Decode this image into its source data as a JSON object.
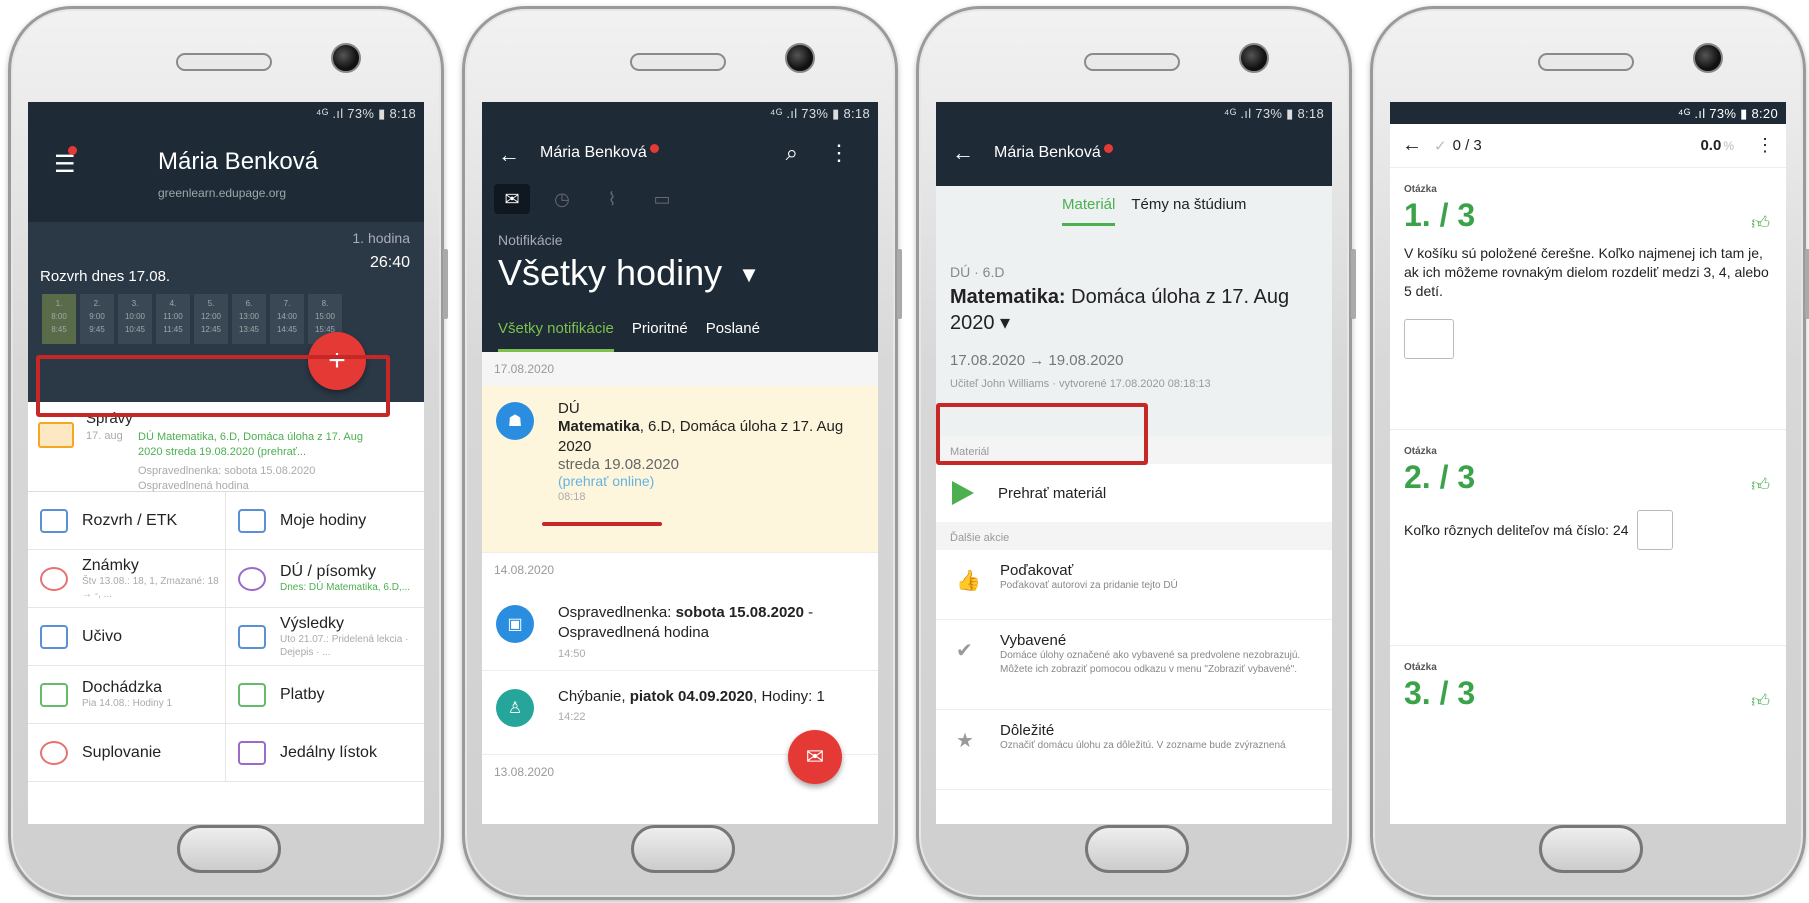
{
  "phone1": {
    "status": "⁴ᴳ .ıl 73% ▮ 8:18",
    "user_name": "Mária Benková",
    "domain": "greenlearn.edupage.org",
    "lesson_label": "1. hodina",
    "timer": "26:40",
    "schedule_title": "Rozvrh dnes 17.08.",
    "schedule_cells": [
      {
        "n": "1.",
        "t": "8:00\n8:45"
      },
      {
        "n": "2.",
        "t": "9:00\n9:45"
      },
      {
        "n": "3.",
        "t": "10:00\n10:45"
      },
      {
        "n": "4.",
        "t": "11:00\n11:45"
      },
      {
        "n": "5.",
        "t": "12:00\n12:45"
      },
      {
        "n": "6.",
        "t": "13:00\n13:45"
      },
      {
        "n": "7.",
        "t": "14:00\n14:45"
      },
      {
        "n": "8.",
        "t": "15:00\n15:45"
      }
    ],
    "fab": "+",
    "messages": {
      "title": "Správy",
      "date": "17. aug",
      "text": "DÚ Matematika, 6.D, Domáca úloha z 17. Aug 2020 streda 19.08.2020 (prehrať...",
      "sub": "Ospravedlnenka: sobota 15.08.2020 Ospravedlnená hodina"
    },
    "menu": [
      {
        "label": "Rozvrh / ETK",
        "sub": ""
      },
      {
        "label": "Moje hodiny",
        "sub": ""
      },
      {
        "label": "Známky",
        "sub": "Štv 13.08.: 18, 1, Zmazané: 18 → -, ..."
      },
      {
        "label": "DÚ / písomky",
        "sub": "Dnes: DÚ Matematika, 6.D,..."
      },
      {
        "label": "Učivo",
        "sub": ""
      },
      {
        "label": "Výsledky",
        "sub": "Uto 21.07.: Pridelená lekcia · Dejepis · ..."
      },
      {
        "label": "Dochádzka",
        "sub": "Pia 14.08.: Hodiny 1"
      },
      {
        "label": "Platby",
        "sub": ""
      },
      {
        "label": "Suplovanie",
        "sub": ""
      },
      {
        "label": "Jedálny lístok",
        "sub": ""
      }
    ]
  },
  "phone2": {
    "status": "⁴ᴳ .ıl 73% ▮ 8:18",
    "back": "←",
    "user_name": "Mária Benková",
    "search": "⌕",
    "more": "⋮",
    "notif_label": "Notifikácie",
    "all_lessons": "Všetky hodiny",
    "tabs": [
      "Všetky notifikácie",
      "Prioritné",
      "Poslané"
    ],
    "date1": "17.08.2020",
    "card": {
      "type": "DÚ",
      "subject": "Matematika",
      "line": ", 6.D, Domáca úloha z 17. Aug 2020",
      "day": "streda 19.08.2020",
      "link": "(prehrať online)",
      "time": "08:18"
    },
    "date2": "14.08.2020",
    "row1": {
      "prefix": "Ospravedlnenka: ",
      "bold": "sobota 15.08.2020",
      "suffix": " - Ospravedlnená hodina",
      "time": "14:50"
    },
    "row2": {
      "prefix": "Chýbanie, ",
      "bold": "piatok 04.09.2020",
      "suffix": ", Hodiny: 1",
      "time": "14:22"
    },
    "date3": "13.08.2020"
  },
  "phone3": {
    "status": "⁴ᴳ .ıl 73% ▮ 8:18",
    "back": "←",
    "user_name": "Mária Benková",
    "tabs": [
      "Materiál",
      "Témy na štúdium"
    ],
    "subject_class": "DÚ · 6.D",
    "title_bold": "Matematika:",
    "title_rest": " Domáca úloha z 17. Aug 2020 ▾",
    "dates": "17.08.2020 → 19.08.2020",
    "meta": "Učiteľ John Williams · vytvorené 17.08.2020 08:18:13",
    "section_material": "Materiál",
    "play_label": "Prehrať materiál",
    "section_more": "Ďalšie akcie",
    "actions": [
      {
        "title": "Poďakovať",
        "desc": "Poďakovať autorovi za pridanie tejto DÚ"
      },
      {
        "title": "Vybavené",
        "desc": "Domáce úlohy označené ako vybavené sa predvolene nezobrazujú. Môžete ich zobraziť pomocou odkazu v menu \"Zobraziť vybavené\"."
      },
      {
        "title": "Dôležité",
        "desc": "Označiť domácu úlohu za dôležitú. V zozname bude zvýraznená"
      }
    ]
  },
  "phone4": {
    "status": "⁴ᴳ .ıl 73% ▮ 8:20",
    "back": "←",
    "progress": "0 / 3",
    "score": "0.0",
    "score_unit": "%",
    "more": "⋮",
    "questions": [
      {
        "label": "Otázka",
        "num": "1. / 3",
        "text": "V košíku sú položené čerešne. Koľko najmenej ich tam je, ak ich môžeme rovnakým dielom rozdeliť medzi 3, 4, alebo 5 detí."
      },
      {
        "label": "Otázka",
        "num": "2. / 3",
        "text": "Koľko rôznych deliteľov má číslo: 24"
      },
      {
        "label": "Otázka",
        "num": "3. / 3",
        "text": ""
      }
    ]
  }
}
